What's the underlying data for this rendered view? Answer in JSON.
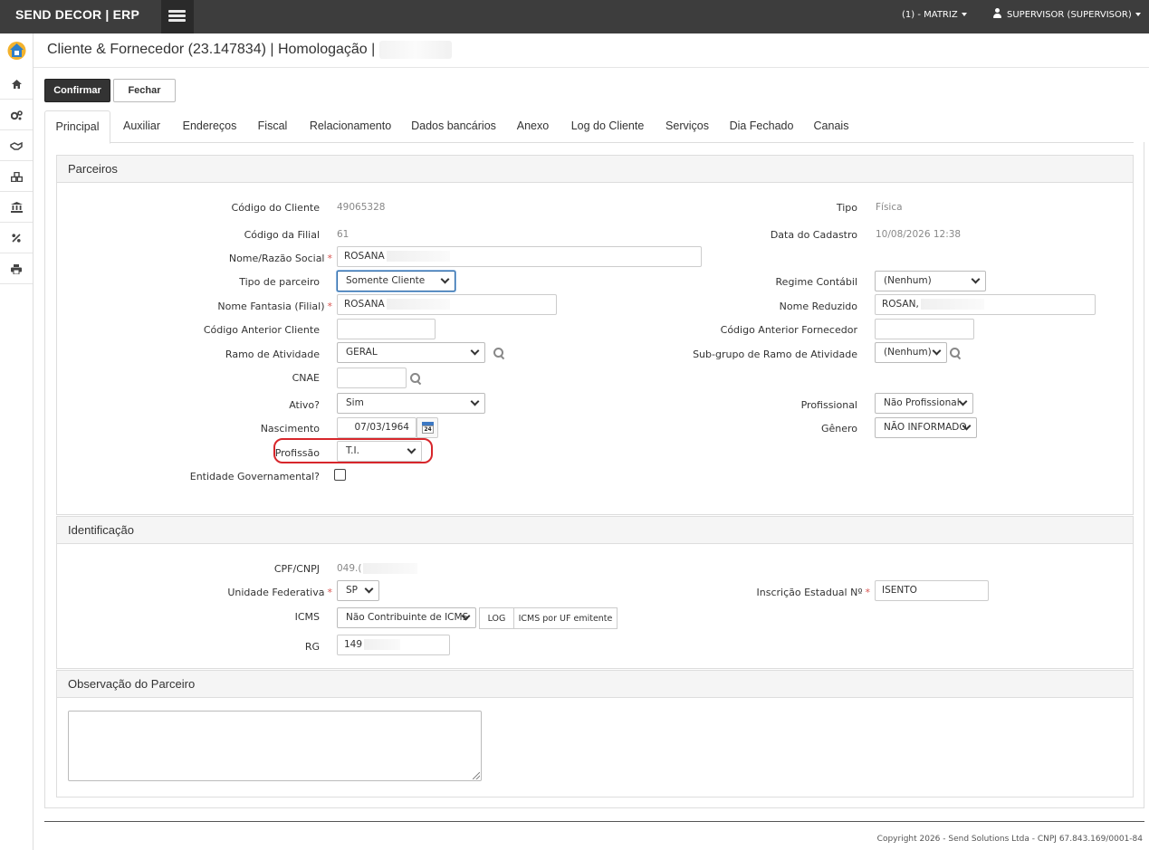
{
  "header": {
    "brand": "SEND DECOR | ERP",
    "branch": "(1) - MATRIZ",
    "user": "SUPERVISOR (SUPERVISOR)"
  },
  "sidebar": {
    "items": [
      "home-icon",
      "gears-icon",
      "handshake-icon",
      "cubes-icon",
      "bank-icon",
      "percent-icon",
      "print-icon"
    ]
  },
  "page": {
    "title": "Cliente & Fornecedor (23.147834) | Homologação |"
  },
  "actions": {
    "confirm": "Confirmar",
    "close": "Fechar"
  },
  "tabs": [
    "Principal",
    "Auxiliar",
    "Endereços",
    "Fiscal",
    "Relacionamento",
    "Dados bancários",
    "Anexo",
    "Log do Cliente",
    "Serviços",
    "Dia Fechado",
    "Canais"
  ],
  "parceiros": {
    "heading": "Parceiros",
    "codigo_cliente_label": "Código do Cliente",
    "codigo_cliente": "49065328",
    "tipo_label": "Tipo",
    "tipo": "Física",
    "codigo_filial_label": "Código da Filial",
    "codigo_filial": "61",
    "data_cadastro_label": "Data do Cadastro",
    "data_cadastro": "10/08/2026 12:38",
    "nome_label": "Nome/Razão Social",
    "nome": "ROSANA",
    "tipo_parceiro_label": "Tipo de parceiro",
    "tipo_parceiro": "Somente Cliente",
    "regime_label": "Regime Contábil",
    "regime": "(Nenhum)",
    "fantasia_label": "Nome Fantasia (Filial)",
    "fantasia": "ROSANA",
    "reduzido_label": "Nome Reduzido",
    "reduzido": "ROSAN,",
    "cod_ant_cliente_label": "Código Anterior Cliente",
    "cod_ant_cliente": "",
    "cod_ant_fornecedor_label": "Código Anterior Fornecedor",
    "cod_ant_fornecedor": "",
    "ramo_label": "Ramo de Atividade",
    "ramo": "GERAL",
    "subgrupo_label": "Sub-grupo de Ramo de Atividade",
    "subgrupo": "(Nenhum)",
    "cnae_label": "CNAE",
    "cnae": "",
    "ativo_label": "Ativo?",
    "ativo": "Sim",
    "profissional_label": "Profissional",
    "profissional": "Não Profissional",
    "nascimento_label": "Nascimento",
    "nascimento": "07/03/1964",
    "calendar_day": "24",
    "genero_label": "Gênero",
    "genero": "NÃO INFORMADO",
    "profissao_label": "Profissão",
    "profissao": "T.I.",
    "governamental_label": "Entidade Governamental?"
  },
  "identificacao": {
    "heading": "Identificação",
    "cpf_label": "CPF/CNPJ",
    "cpf": "049.(",
    "uf_label": "Unidade Federativa",
    "uf": "SP",
    "ie_label": "Inscrição Estadual Nº",
    "ie": "ISENTO",
    "icms_label": "ICMS",
    "icms": "Não Contribuinte de ICMS",
    "log_button": "LOG",
    "icms_uf_button": "ICMS por UF emitente",
    "rg_label": "RG",
    "rg": "149"
  },
  "observacao": {
    "heading": "Observação do Parceiro",
    "text": ""
  },
  "footer": {
    "copyright": "Copyright 2026 - Send Solutions Ltda - CNPJ 67.843.169/0001-84"
  },
  "colors": {
    "topbar": "#3d3d3d",
    "required": "#d9534f",
    "highlight": "#d7262b"
  }
}
